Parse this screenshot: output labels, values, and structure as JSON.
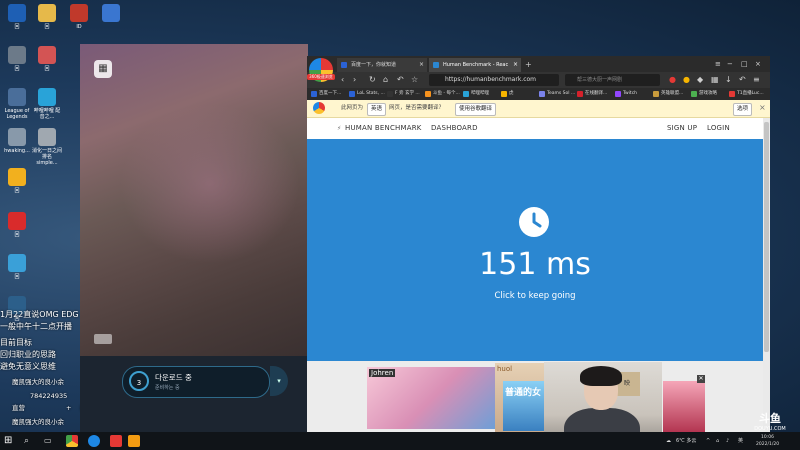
{
  "desktop": {
    "icons": [
      {
        "label": "回",
        "color": "#1e5fb4"
      },
      {
        "label": "回",
        "color": "#e6b94a"
      },
      {
        "label": "ID",
        "color": "#c0392b"
      },
      {
        "label": "",
        "color": "#3a76d0"
      },
      {
        "label": "回",
        "color": "#6c7a89"
      },
      {
        "label": "回",
        "color": "#d35454"
      },
      {
        "label": "League of Legends",
        "color": "#4a6e9a"
      },
      {
        "label": "哔哩哔哩 配音之...",
        "color": "#29a3d8"
      },
      {
        "label": "hwaking...",
        "color": "#8899aa"
      },
      {
        "label": "消化一日之间 排名simple...",
        "color": "#a0a8b0"
      },
      {
        "label": "回",
        "color": "#f2b01e"
      },
      {
        "label": "回",
        "color": "#d92b2b"
      },
      {
        "label": "回",
        "color": "#3aa0d8"
      },
      {
        "label": "回",
        "color": "#2c5f8a"
      }
    ],
    "overlay": {
      "line1": "1月22直说OMG EDG",
      "line2": "一般中午十二点开播",
      "line3": "目前目标",
      "line4": "回归职业的思路",
      "line5": "避免无意义思维",
      "fan1": "魔凯强大的良小余",
      "fan2": "直营",
      "fan2b": "+",
      "fan2c": "群",
      "qq": "784224935",
      "fan3": "魔凯强大的良小余"
    }
  },
  "launcher": {
    "download_step": "3",
    "download_title": "다운로드 중",
    "download_sub": "준비하는 중",
    "dropdown_icon": "▾"
  },
  "browser": {
    "logo_caption": "360极速浏览",
    "tabs": [
      {
        "title": "百度一下，你就知道",
        "fav_color": "#2b62d6"
      },
      {
        "title": "Human Benchmark - Reac",
        "fav_color": "#2b87d1"
      }
    ],
    "new_tab": "+",
    "url": "https://humanbenchmark.com",
    "search_placeholder": "帮三德大厨一声网剧",
    "bookmarks": [
      {
        "label": "百度一下...",
        "color": "#2b62d6"
      },
      {
        "label": "LoL Stats, ...",
        "color": "#2b62d6"
      },
      {
        "label": "F 旁 玄学 ...",
        "color": "#333"
      },
      {
        "label": "斗鱼 - 每个...",
        "color": "#f7931e"
      },
      {
        "label": "哔哩哔哩",
        "color": "#29a3d8"
      },
      {
        "label": "虎",
        "color": "#f7b500"
      },
      {
        "label": "Teams Sol ...",
        "color": "#7b83eb"
      },
      {
        "label": "在线翻译...",
        "color": "#d6212b"
      },
      {
        "label": "Twitch",
        "color": "#9146ff"
      },
      {
        "label": "英雄联盟...",
        "color": "#c89b3c"
      },
      {
        "label": "游戏攻略",
        "color": "#4caf50"
      },
      {
        "label": "T1直播Luc...",
        "color": "#e53935"
      }
    ],
    "translate": {
      "prefix": "此网页为",
      "lang": "英语",
      "mid": "网页，是否需要翻译？",
      "action": "使用谷歌翻译",
      "options": "选项",
      "close": "×"
    },
    "site_nav": {
      "brand": "HUMAN BENCHMARK",
      "dashboard": "DASHBOARD",
      "signup": "SIGN UP",
      "login": "LOGIN"
    },
    "test": {
      "result": "151 ms",
      "hint": "Click to keep going"
    },
    "ads": {
      "ad1": "Johren",
      "ad2": "huol",
      "ad3": "普通的女",
      "close": "✕"
    }
  },
  "webcam": {
    "poster": "映"
  },
  "watermark": {
    "main": "斗鱼",
    "sub": "DOUYU.COM"
  },
  "taskbar": {
    "weather": "6℃ 多云",
    "ime": "英",
    "time": "10:06",
    "date": "2022/1/20"
  },
  "colors": {
    "hero_blue": "#2b87d1",
    "accent": "#ffd154"
  }
}
